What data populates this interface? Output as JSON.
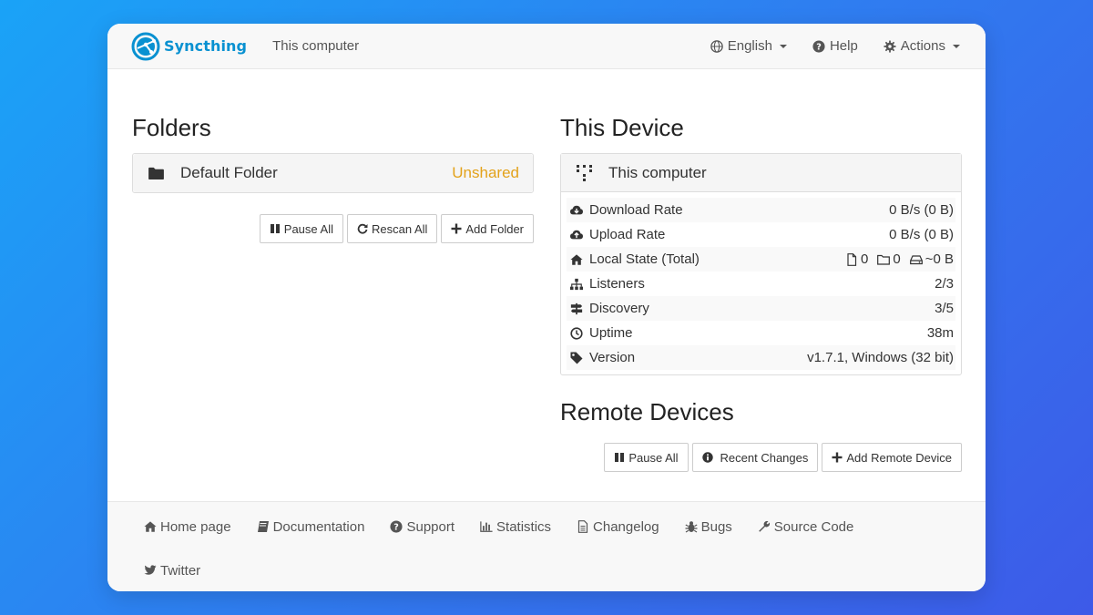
{
  "navbar": {
    "brand": "Syncthing",
    "device_name": "This computer",
    "language": "English",
    "help": "Help",
    "actions": "Actions"
  },
  "folders": {
    "title": "Folders",
    "items": [
      {
        "name": "Default Folder",
        "status": "Unshared"
      }
    ],
    "buttons": {
      "pause_all": "Pause All",
      "rescan_all": "Rescan All",
      "add_folder": "Add Folder"
    }
  },
  "this_device": {
    "title": "This Device",
    "name": "This computer",
    "rows": {
      "download_rate": {
        "label": "Download Rate",
        "value": "0 B/s (0 B)"
      },
      "upload_rate": {
        "label": "Upload Rate",
        "value": "0 B/s (0 B)"
      },
      "local_state": {
        "label": "Local State (Total)",
        "files": "0",
        "dirs": "0",
        "size": "~0 B"
      },
      "listeners": {
        "label": "Listeners",
        "value": "2/3"
      },
      "discovery": {
        "label": "Discovery",
        "value": "3/5"
      },
      "uptime": {
        "label": "Uptime",
        "value": "38m"
      },
      "version": {
        "label": "Version",
        "value": "v1.7.1, Windows (32 bit)"
      }
    }
  },
  "remote_devices": {
    "title": "Remote Devices",
    "buttons": {
      "pause_all": "Pause All",
      "recent_changes": "Recent Changes",
      "add_remote_device": "Add Remote Device"
    }
  },
  "footer": {
    "links": {
      "home_page": "Home page",
      "documentation": "Documentation",
      "support": "Support",
      "statistics": "Statistics",
      "changelog": "Changelog",
      "bugs": "Bugs",
      "source_code": "Source Code",
      "twitter": "Twitter"
    }
  },
  "colors": {
    "brand": "#0891d1",
    "unshared": "#e3a21a",
    "background_start": "#1aa3f7",
    "background_end": "#3d5ae8"
  }
}
